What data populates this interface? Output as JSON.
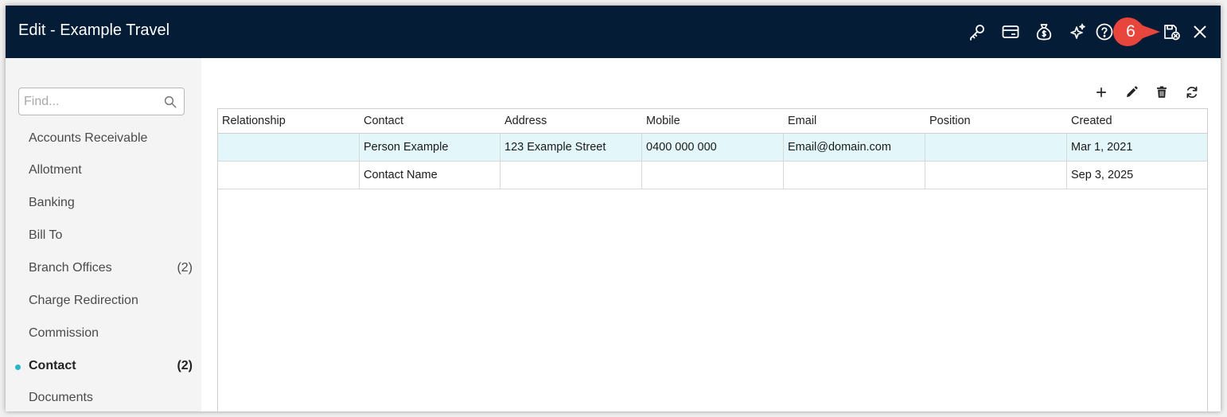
{
  "window": {
    "title": "Edit - Example Travel"
  },
  "header_icons": [
    "key-icon",
    "card-icon",
    "money-bag-icon",
    "sparkle-icon",
    "help-icon",
    "save-close-icon",
    "close-icon"
  ],
  "callout": {
    "number": "6",
    "color": "#e8453c"
  },
  "sidebar": {
    "search_placeholder": "Find...",
    "items": [
      {
        "label": "Accounts Receivable",
        "count": ""
      },
      {
        "label": "Allotment",
        "count": ""
      },
      {
        "label": "Banking",
        "count": ""
      },
      {
        "label": "Bill To",
        "count": ""
      },
      {
        "label": "Branch Offices",
        "count": "(2)"
      },
      {
        "label": "Charge Redirection",
        "count": ""
      },
      {
        "label": "Commission",
        "count": ""
      },
      {
        "label": "Contact",
        "count": "(2)",
        "active": true
      },
      {
        "label": "Documents",
        "count": ""
      }
    ]
  },
  "toolbar": [
    "add-icon",
    "edit-icon",
    "delete-icon",
    "refresh-icon"
  ],
  "table": {
    "columns": [
      "Relationship",
      "Contact",
      "Address",
      "Mobile",
      "Email",
      "Position",
      "Created"
    ],
    "rows": [
      [
        "",
        "Person Example",
        "123 Example Street",
        "0400 000 000",
        "Email@domain.com",
        "",
        "Mar 1, 2021"
      ],
      [
        "",
        "Contact Name",
        "",
        "",
        "",
        "",
        "Sep 3, 2025"
      ]
    ],
    "selected_row": 0
  },
  "colors": {
    "titlebar": "#041c36",
    "active_dot": "#27b7c9",
    "selected_row": "#e3f7fb",
    "callout": "#e8453c"
  }
}
